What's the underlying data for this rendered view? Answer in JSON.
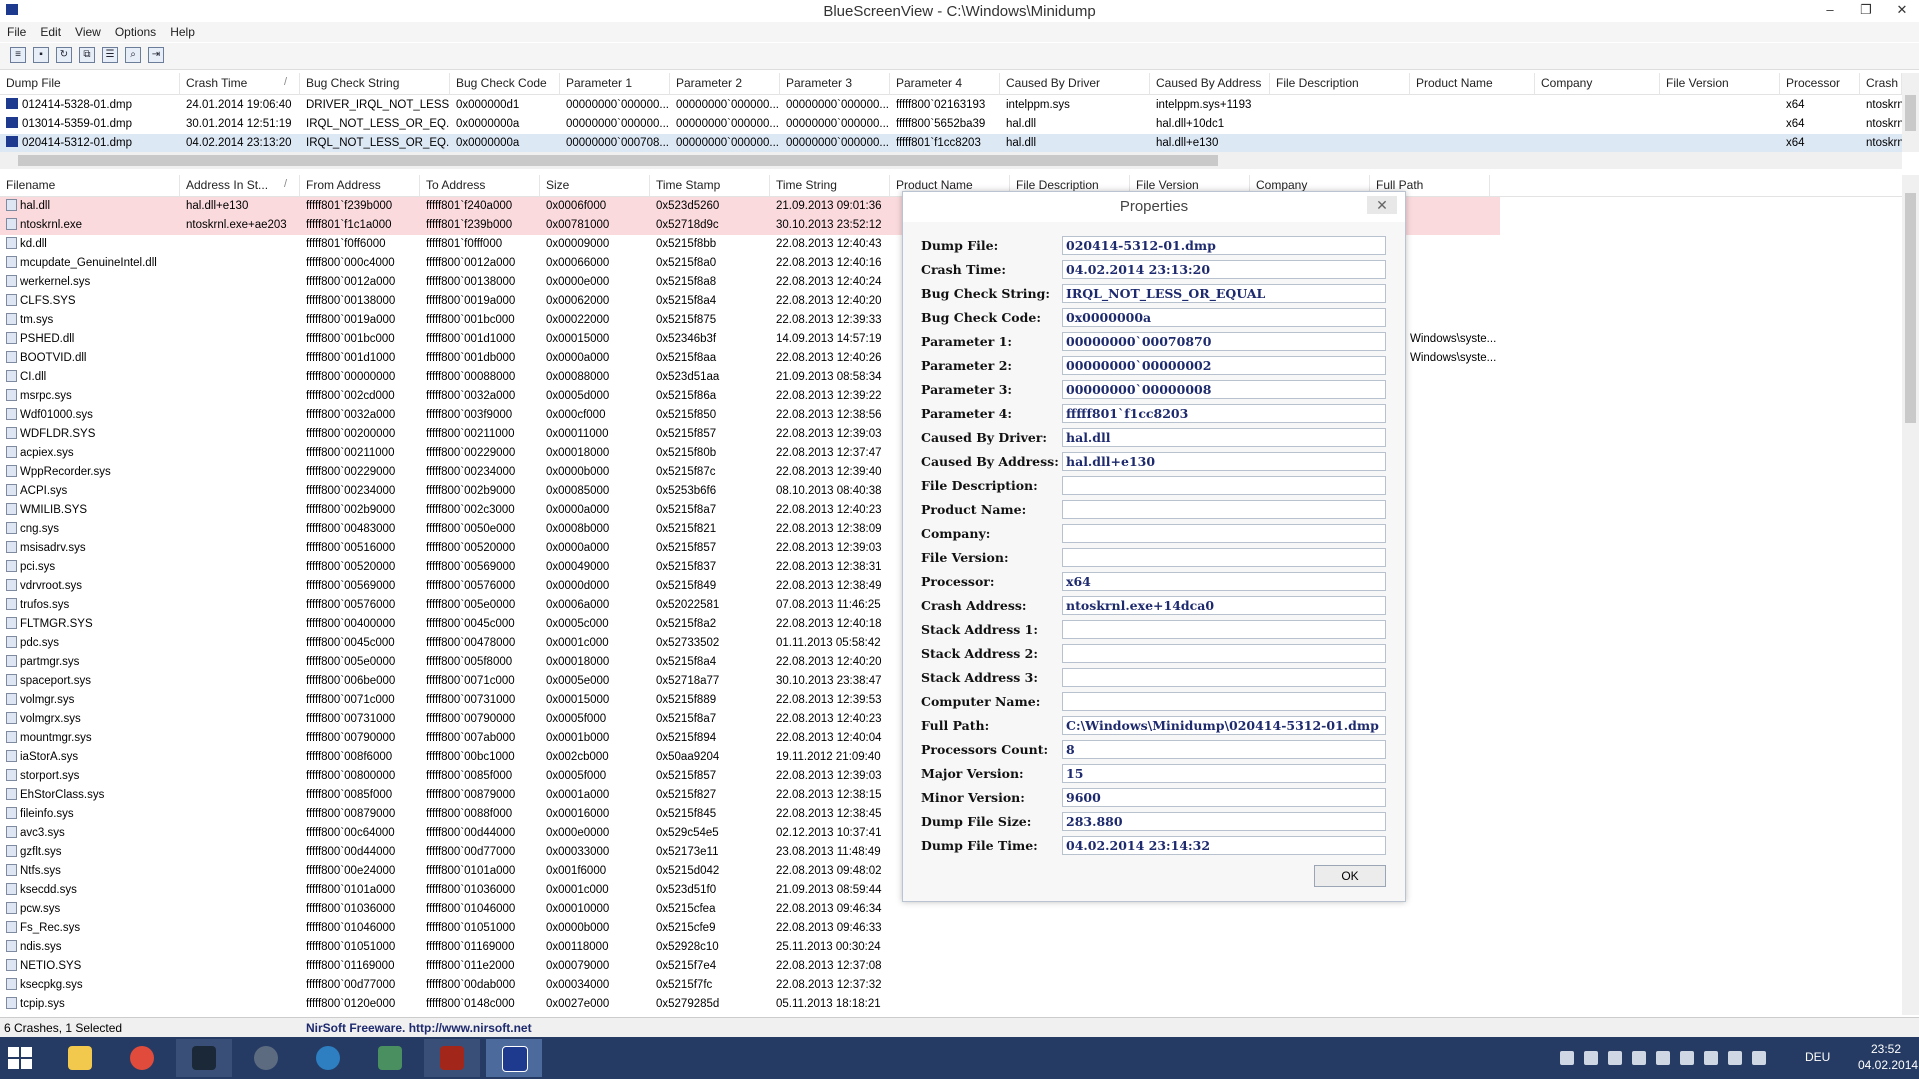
{
  "window": {
    "title": "BlueScreenView  -  C:\\Windows\\Minidump",
    "minimize": "–",
    "maximize": "❐",
    "close": "✕"
  },
  "menu": [
    "File",
    "Edit",
    "View",
    "Options",
    "Help"
  ],
  "toolbar": [
    "save-html-icon",
    "save-icon",
    "refresh-icon",
    "copy-icon",
    "properties-icon",
    "find-icon",
    "exit-icon"
  ],
  "crash_grid": {
    "columns": [
      "Dump File",
      "Crash Time",
      "Bug Check String",
      "Bug Check Code",
      "Parameter 1",
      "Parameter 2",
      "Parameter 3",
      "Parameter 4",
      "Caused By Driver",
      "Caused By Address",
      "File Description",
      "Product Name",
      "Company",
      "File Version",
      "Processor",
      "Crash ..."
    ],
    "sort_mark": "/",
    "rows": [
      [
        "012414-5328-01.dmp",
        "24.01.2014 19:06:40",
        "DRIVER_IRQL_NOT_LESS...",
        "0x000000d1",
        "00000000`000000...",
        "00000000`000000...",
        "00000000`000000...",
        "fffff800`02163193",
        "intelppm.sys",
        "intelppm.sys+1193",
        "",
        "",
        "",
        "",
        "x64",
        "ntoskrn"
      ],
      [
        "013014-5359-01.dmp",
        "30.01.2014 12:51:19",
        "IRQL_NOT_LESS_OR_EQ...",
        "0x0000000a",
        "00000000`000000...",
        "00000000`000000...",
        "00000000`000000...",
        "fffff800`5652ba39",
        "hal.dll",
        "hal.dll+10dc1",
        "",
        "",
        "",
        "",
        "x64",
        "ntoskrn"
      ],
      [
        "020414-5312-01.dmp",
        "04.02.2014 23:13:20",
        "IRQL_NOT_LESS_OR_EQ...",
        "0x0000000a",
        "00000000`000708...",
        "00000000`000000...",
        "00000000`000000...",
        "fffff801`f1cc8203",
        "hal.dll",
        "hal.dll+e130",
        "",
        "",
        "",
        "",
        "x64",
        "ntoskrn"
      ]
    ]
  },
  "driver_grid": {
    "columns": [
      "Filename",
      "Address In St...",
      "From Address",
      "To Address",
      "Size",
      "Time Stamp",
      "Time String",
      "Product Name",
      "File Description",
      "File Version",
      "Company",
      "Full Path"
    ],
    "sort_mark": "/",
    "rows": [
      [
        "hal.dll",
        "hal.dll+e130",
        "fffff801`f239b000",
        "fffff801`f240a000",
        "0x0006f000",
        "0x523d5260",
        "21.09.2013 09:01:36"
      ],
      [
        "ntoskrnl.exe",
        "ntoskrnl.exe+ae203",
        "fffff801`f1c1a000",
        "fffff801`f239b000",
        "0x00781000",
        "0x52718d9c",
        "30.10.2013 23:52:12"
      ],
      [
        "kd.dll",
        "",
        "fffff801`f0ff6000",
        "fffff801`f0fff000",
        "0x00009000",
        "0x5215f8bb",
        "22.08.2013 12:40:43"
      ],
      [
        "mcupdate_GenuineIntel.dll",
        "",
        "fffff800`000c4000",
        "fffff800`0012a000",
        "0x00066000",
        "0x5215f8a0",
        "22.08.2013 12:40:16"
      ],
      [
        "werkernel.sys",
        "",
        "fffff800`0012a000",
        "fffff800`00138000",
        "0x0000e000",
        "0x5215f8a8",
        "22.08.2013 12:40:24"
      ],
      [
        "CLFS.SYS",
        "",
        "fffff800`00138000",
        "fffff800`0019a000",
        "0x00062000",
        "0x5215f8a4",
        "22.08.2013 12:40:20"
      ],
      [
        "tm.sys",
        "",
        "fffff800`0019a000",
        "fffff800`001bc000",
        "0x00022000",
        "0x5215f875",
        "22.08.2013 12:39:33"
      ],
      [
        "PSHED.dll",
        "",
        "fffff800`001bc000",
        "fffff800`001d1000",
        "0x00015000",
        "0x52346b3f",
        "14.09.2013 14:57:19"
      ],
      [
        "BOOTVID.dll",
        "",
        "fffff800`001d1000",
        "fffff800`001db000",
        "0x0000a000",
        "0x5215f8aa",
        "22.08.2013 12:40:26"
      ],
      [
        "CI.dll",
        "",
        "fffff800`00000000",
        "fffff800`00088000",
        "0x00088000",
        "0x523d51aa",
        "21.09.2013 08:58:34"
      ],
      [
        "msrpc.sys",
        "",
        "fffff800`002cd000",
        "fffff800`0032a000",
        "0x0005d000",
        "0x5215f86a",
        "22.08.2013 12:39:22"
      ],
      [
        "Wdf01000.sys",
        "",
        "fffff800`0032a000",
        "fffff800`003f9000",
        "0x000cf000",
        "0x5215f850",
        "22.08.2013 12:38:56"
      ],
      [
        "WDFLDR.SYS",
        "",
        "fffff800`00200000",
        "fffff800`00211000",
        "0x00011000",
        "0x5215f857",
        "22.08.2013 12:39:03"
      ],
      [
        "acpiex.sys",
        "",
        "fffff800`00211000",
        "fffff800`00229000",
        "0x00018000",
        "0x5215f80b",
        "22.08.2013 12:37:47"
      ],
      [
        "WppRecorder.sys",
        "",
        "fffff800`00229000",
        "fffff800`00234000",
        "0x0000b000",
        "0x5215f87c",
        "22.08.2013 12:39:40"
      ],
      [
        "ACPI.sys",
        "",
        "fffff800`00234000",
        "fffff800`002b9000",
        "0x00085000",
        "0x5253b6f6",
        "08.10.2013 08:40:38"
      ],
      [
        "WMILIB.SYS",
        "",
        "fffff800`002b9000",
        "fffff800`002c3000",
        "0x0000a000",
        "0x5215f8a7",
        "22.08.2013 12:40:23"
      ],
      [
        "cng.sys",
        "",
        "fffff800`00483000",
        "fffff800`0050e000",
        "0x0008b000",
        "0x5215f821",
        "22.08.2013 12:38:09"
      ],
      [
        "msisadrv.sys",
        "",
        "fffff800`00516000",
        "fffff800`00520000",
        "0x0000a000",
        "0x5215f857",
        "22.08.2013 12:39:03"
      ],
      [
        "pci.sys",
        "",
        "fffff800`00520000",
        "fffff800`00569000",
        "0x00049000",
        "0x5215f837",
        "22.08.2013 12:38:31"
      ],
      [
        "vdrvroot.sys",
        "",
        "fffff800`00569000",
        "fffff800`00576000",
        "0x0000d000",
        "0x5215f849",
        "22.08.2013 12:38:49"
      ],
      [
        "trufos.sys",
        "",
        "fffff800`00576000",
        "fffff800`005e0000",
        "0x0006a000",
        "0x52022581",
        "07.08.2013 11:46:25"
      ],
      [
        "FLTMGR.SYS",
        "",
        "fffff800`00400000",
        "fffff800`0045c000",
        "0x0005c000",
        "0x5215f8a2",
        "22.08.2013 12:40:18"
      ],
      [
        "pdc.sys",
        "",
        "fffff800`0045c000",
        "fffff800`00478000",
        "0x0001c000",
        "0x52733502",
        "01.11.2013 05:58:42"
      ],
      [
        "partmgr.sys",
        "",
        "fffff800`005e0000",
        "fffff800`005f8000",
        "0x00018000",
        "0x5215f8a4",
        "22.08.2013 12:40:20"
      ],
      [
        "spaceport.sys",
        "",
        "fffff800`006be000",
        "fffff800`0071c000",
        "0x0005e000",
        "0x52718a77",
        "30.10.2013 23:38:47"
      ],
      [
        "volmgr.sys",
        "",
        "fffff800`0071c000",
        "fffff800`00731000",
        "0x00015000",
        "0x5215f889",
        "22.08.2013 12:39:53"
      ],
      [
        "volmgrx.sys",
        "",
        "fffff800`00731000",
        "fffff800`00790000",
        "0x0005f000",
        "0x5215f8a7",
        "22.08.2013 12:40:23"
      ],
      [
        "mountmgr.sys",
        "",
        "fffff800`00790000",
        "fffff800`007ab000",
        "0x0001b000",
        "0x5215f894",
        "22.08.2013 12:40:04"
      ],
      [
        "iaStorA.sys",
        "",
        "fffff800`008f6000",
        "fffff800`00bc1000",
        "0x002cb000",
        "0x50aa9204",
        "19.11.2012 21:09:40"
      ],
      [
        "storport.sys",
        "",
        "fffff800`00800000",
        "fffff800`0085f000",
        "0x0005f000",
        "0x5215f857",
        "22.08.2013 12:39:03"
      ],
      [
        "EhStorClass.sys",
        "",
        "fffff800`0085f000",
        "fffff800`00879000",
        "0x0001a000",
        "0x5215f827",
        "22.08.2013 12:38:15"
      ],
      [
        "fileinfo.sys",
        "",
        "fffff800`00879000",
        "fffff800`0088f000",
        "0x00016000",
        "0x5215f845",
        "22.08.2013 12:38:45"
      ],
      [
        "avc3.sys",
        "",
        "fffff800`00c64000",
        "fffff800`00d44000",
        "0x000e0000",
        "0x529c54e5",
        "02.12.2013 10:37:41"
      ],
      [
        "gzflt.sys",
        "",
        "fffff800`00d44000",
        "fffff800`00d77000",
        "0x00033000",
        "0x52173e11",
        "23.08.2013 11:48:49"
      ],
      [
        "Ntfs.sys",
        "",
        "fffff800`00e24000",
        "fffff800`0101a000",
        "0x001f6000",
        "0x5215d042",
        "22.08.2013 09:48:02"
      ],
      [
        "ksecdd.sys",
        "",
        "fffff800`0101a000",
        "fffff800`01036000",
        "0x0001c000",
        "0x523d51f0",
        "21.09.2013 08:59:44"
      ],
      [
        "pcw.sys",
        "",
        "fffff800`01036000",
        "fffff800`01046000",
        "0x00010000",
        "0x5215cfea",
        "22.08.2013 09:46:34"
      ],
      [
        "Fs_Rec.sys",
        "",
        "fffff800`01046000",
        "fffff800`01051000",
        "0x0000b000",
        "0x5215cfe9",
        "22.08.2013 09:46:33"
      ],
      [
        "ndis.sys",
        "",
        "fffff800`01051000",
        "fffff800`01169000",
        "0x00118000",
        "0x52928c10",
        "25.11.2013 00:30:24"
      ],
      [
        "NETIO.SYS",
        "",
        "fffff800`01169000",
        "fffff800`011e2000",
        "0x00079000",
        "0x5215f7e4",
        "22.08.2013 12:37:08"
      ],
      [
        "ksecpkg.sys",
        "",
        "fffff800`00d77000",
        "fffff800`00dab000",
        "0x00034000",
        "0x5215f7fc",
        "22.08.2013 12:37:32"
      ],
      [
        "tcpip.sys",
        "",
        "fffff800`0120e000",
        "fffff800`0148c000",
        "0x0027e000",
        "0x5279285d",
        "05.11.2013 18:18:21"
      ]
    ],
    "fullpath_fragments": [
      "Windows\\syste...",
      "Windows\\syste..."
    ]
  },
  "properties": {
    "title": "Properties",
    "close": "✕",
    "ok_label": "OK",
    "fields": [
      {
        "label": "Dump File:",
        "value": "020414-5312-01.dmp"
      },
      {
        "label": "Crash Time:",
        "value": "04.02.2014 23:13:20"
      },
      {
        "label": "Bug Check String:",
        "value": "IRQL_NOT_LESS_OR_EQUAL"
      },
      {
        "label": "Bug Check Code:",
        "value": "0x0000000a"
      },
      {
        "label": "Parameter 1:",
        "value": "00000000`00070870"
      },
      {
        "label": "Parameter 2:",
        "value": "00000000`00000002"
      },
      {
        "label": "Parameter 3:",
        "value": "00000000`00000008"
      },
      {
        "label": "Parameter 4:",
        "value": "fffff801`f1cc8203"
      },
      {
        "label": "Caused By Driver:",
        "value": "hal.dll"
      },
      {
        "label": "Caused By Address:",
        "value": "hal.dll+e130"
      },
      {
        "label": "File Description:",
        "value": ""
      },
      {
        "label": "Product Name:",
        "value": ""
      },
      {
        "label": "Company:",
        "value": ""
      },
      {
        "label": "File Version:",
        "value": ""
      },
      {
        "label": "Processor:",
        "value": "x64"
      },
      {
        "label": "Crash Address:",
        "value": "ntoskrnl.exe+14dca0"
      },
      {
        "label": "Stack Address 1:",
        "value": ""
      },
      {
        "label": "Stack Address 2:",
        "value": ""
      },
      {
        "label": "Stack Address 3:",
        "value": ""
      },
      {
        "label": "Computer Name:",
        "value": ""
      },
      {
        "label": "Full Path:",
        "value": "C:\\Windows\\Minidump\\020414-5312-01.dmp"
      },
      {
        "label": "Processors Count:",
        "value": "8"
      },
      {
        "label": "Major Version:",
        "value": "15"
      },
      {
        "label": "Minor Version:",
        "value": "9600"
      },
      {
        "label": "Dump File Size:",
        "value": "283.880"
      },
      {
        "label": "Dump File Time:",
        "value": "04.02.2014 23:14:32"
      }
    ]
  },
  "status": {
    "count_text": "6 Crashes, 1 Selected",
    "credit_text": "NirSoft Freeware.  http://www.nirsoft.net"
  },
  "taskbar": {
    "apps": [
      "file-explorer-icon",
      "chrome-icon",
      "steam-icon",
      "media-player-icon",
      "teamspeak-icon",
      "app-icon",
      "dota-icon",
      "bluescreenview-icon"
    ],
    "language": "DEU",
    "time": "23:52",
    "date": "04.02.2014"
  },
  "colors": {
    "selected_row": "#dde8f5",
    "highlighted_driver_row": "#fadadd",
    "field_text": "#1e2a6e",
    "taskbar": "#253b63"
  }
}
